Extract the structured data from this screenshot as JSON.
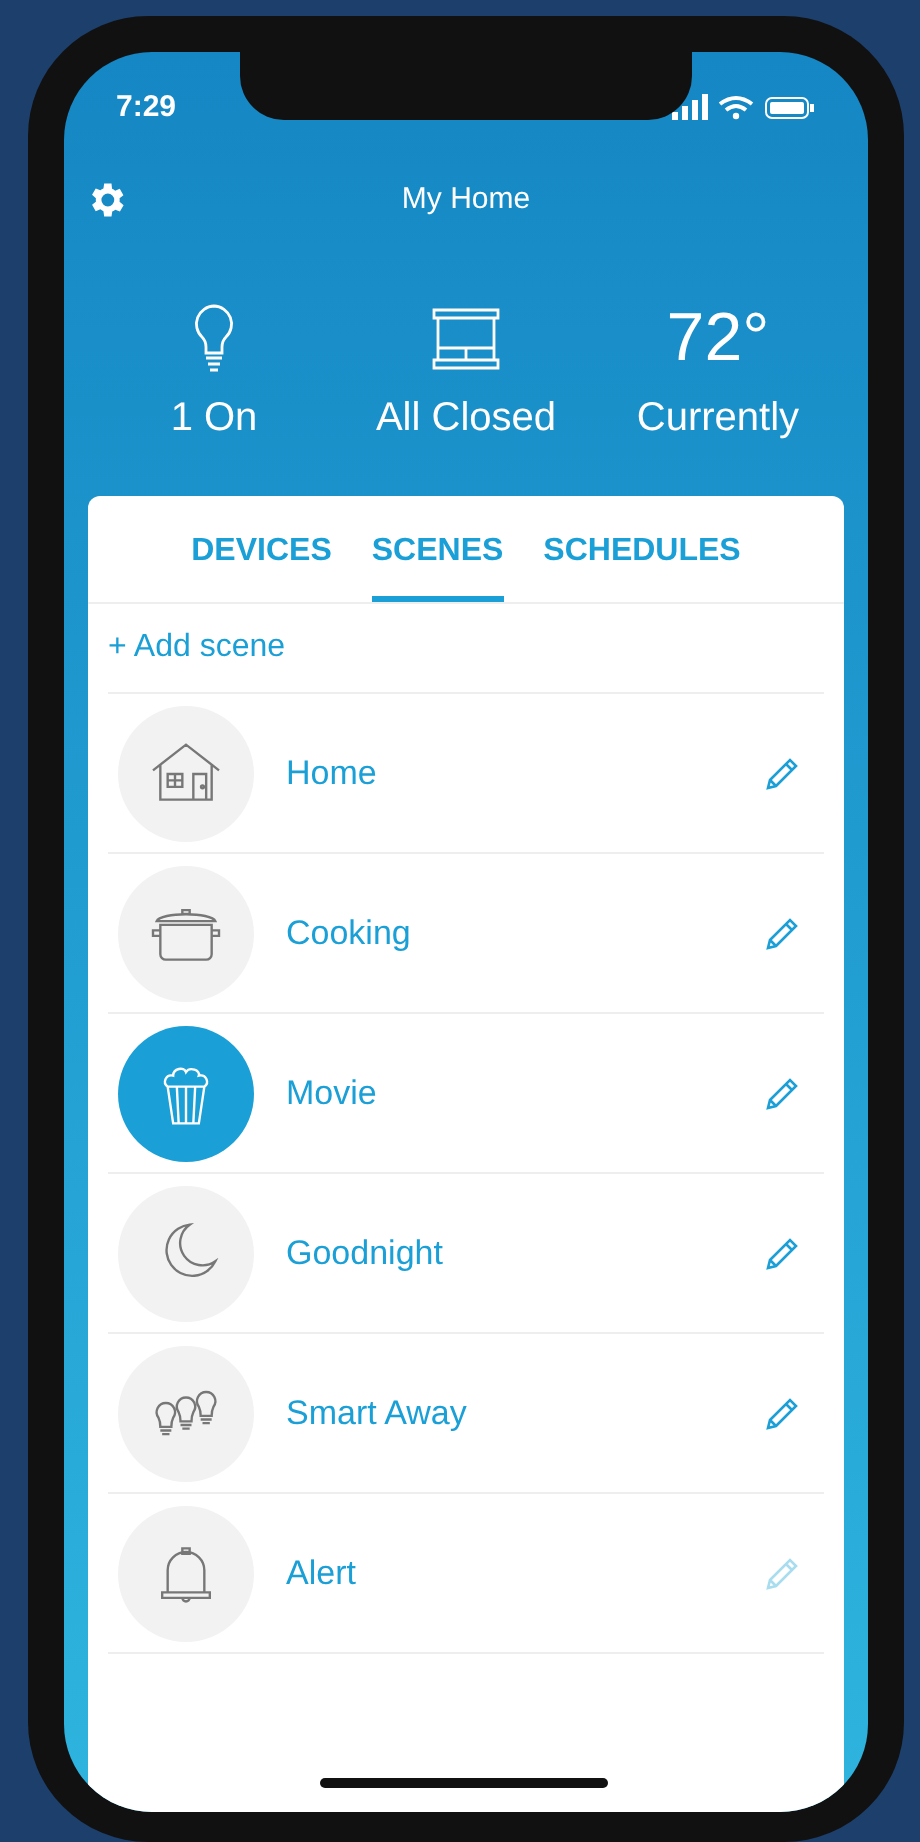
{
  "status_bar": {
    "time": "7:29"
  },
  "header": {
    "title": "My Home"
  },
  "summary": [
    {
      "kind": "bulb",
      "value": "1 On"
    },
    {
      "kind": "shade",
      "value": "All Closed"
    },
    {
      "kind": "temp",
      "reading": "72°",
      "value": "Currently"
    }
  ],
  "tabs": [
    {
      "label": "DEVICES",
      "selected": false
    },
    {
      "label": "SCENES",
      "selected": true
    },
    {
      "label": "SCHEDULES",
      "selected": false
    }
  ],
  "add_link": "+ Add scene",
  "scenes": [
    {
      "kind": "house",
      "name": "Home",
      "active": false,
      "editable": true
    },
    {
      "kind": "pot",
      "name": "Cooking",
      "active": false,
      "editable": true
    },
    {
      "kind": "popcorn",
      "name": "Movie",
      "active": true,
      "editable": true
    },
    {
      "kind": "moon",
      "name": "Goodnight",
      "active": false,
      "editable": true
    },
    {
      "kind": "bulbs",
      "name": "Smart Away",
      "active": false,
      "editable": true
    },
    {
      "kind": "bell",
      "name": "Alert",
      "active": false,
      "editable": false
    }
  ]
}
